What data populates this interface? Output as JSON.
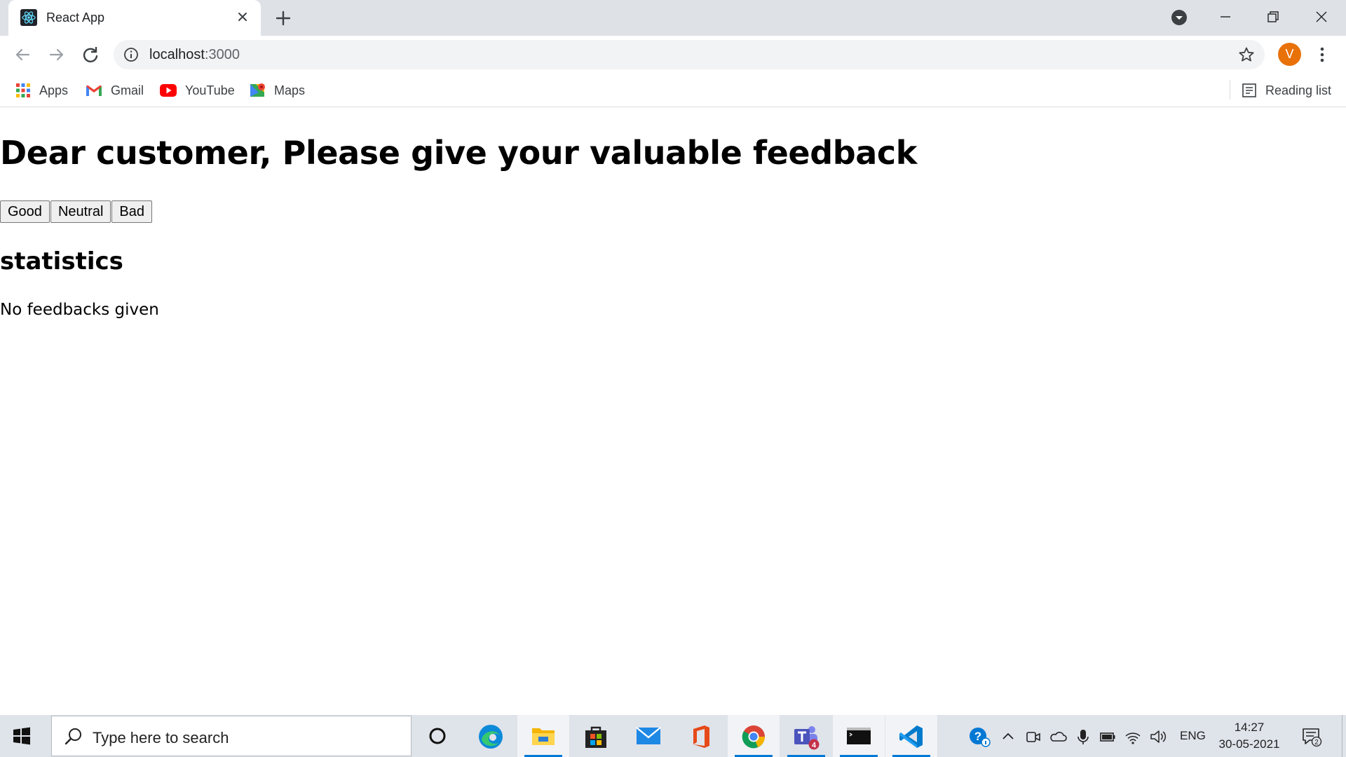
{
  "browser": {
    "tab_title": "React App",
    "url_host": "localhost",
    "url_port": ":3000",
    "profile_initial": "V",
    "bookmarks": [
      "Apps",
      "Gmail",
      "YouTube",
      "Maps"
    ],
    "reading_list": "Reading list"
  },
  "page": {
    "heading": "Dear customer, Please give your valuable feedback",
    "buttons": {
      "good": "Good",
      "neutral": "Neutral",
      "bad": "Bad"
    },
    "statistics_heading": "statistics",
    "message": "No feedbacks given"
  },
  "taskbar": {
    "search_placeholder": "Type here to search",
    "language": "ENG",
    "time": "14:27",
    "date": "30-05-2021",
    "teams_badge": "4",
    "notification_count": "2"
  },
  "colors": {
    "tabstrip": "#dee1e6",
    "avatar": "#e8710a",
    "taskbar": "#dfe3ea",
    "taskbar_indicator": "#0078d4"
  }
}
